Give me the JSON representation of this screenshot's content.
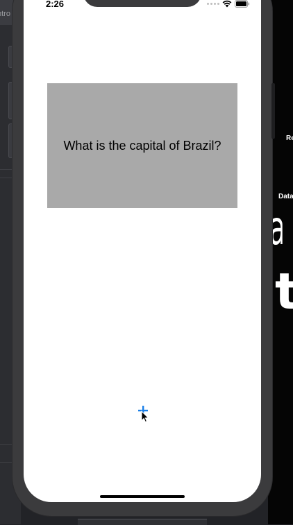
{
  "background": {
    "left_tab_label": "ntro",
    "right_texts": {
      "label_1": "Re",
      "label_2": "Data",
      "big_1": "al",
      "big_2": "t"
    }
  },
  "status_bar": {
    "time": "2:26",
    "icons": [
      "signal-dots",
      "wifi-icon",
      "battery-icon"
    ]
  },
  "card": {
    "question": "What is the capital of Brazil?",
    "background_color": "#a9a9a9"
  },
  "add_button": {
    "icon": "plus-icon",
    "color": "#1a7fe8"
  }
}
